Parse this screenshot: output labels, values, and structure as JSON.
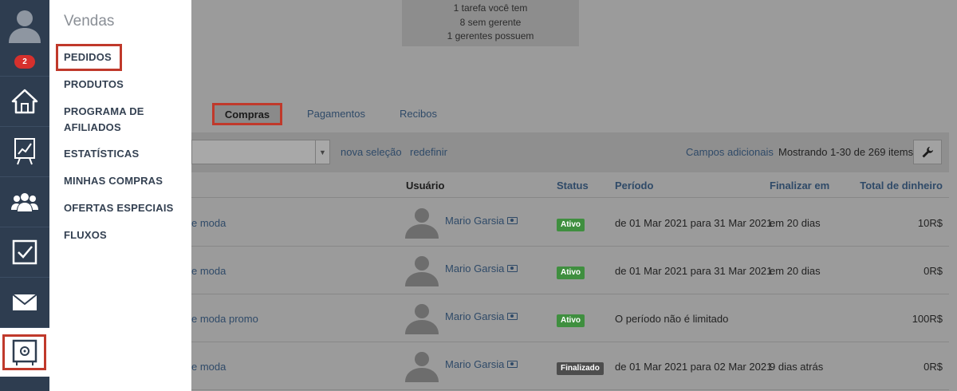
{
  "rail": {
    "badge": "2",
    "icons": [
      "home-icon",
      "chart-icon",
      "users-icon",
      "tasks-icon",
      "mail-icon",
      "sales-icon"
    ]
  },
  "menu": {
    "title": "Vendas",
    "items": [
      {
        "label": "PEDIDOS"
      },
      {
        "label": "PRODUTOS"
      },
      {
        "label": "PROGRAMA DE AFILIADOS"
      },
      {
        "label": "ESTATÍSTICAS"
      },
      {
        "label": "MINHAS COMPRAS"
      },
      {
        "label": "OFERTAS ESPECIAIS"
      },
      {
        "label": "FLUXOS"
      }
    ]
  },
  "summary": {
    "line1": "1 tarefa você tem",
    "line2": "8 sem gerente",
    "line3": "1 gerentes possuem"
  },
  "tabs": {
    "active": "Compras",
    "pagamentos": "Pagamentos",
    "recibos": "Recibos"
  },
  "toolbar": {
    "nova_selecao": "nova seleção",
    "redefinir": "redefinir",
    "campos_adicionais": "Campos adicionais",
    "mostrando": "Mostrando 1-30 de 269 items."
  },
  "table": {
    "headers": {
      "usuario": "Usuário",
      "status": "Status",
      "periodo": "Período",
      "finalizar": "Finalizar em",
      "total": "Total de dinheiro"
    },
    "rows": [
      {
        "name": "e moda",
        "user": "Mario Garsia",
        "status": "Ativo",
        "status_type": "ativo",
        "period": "de 01 Mar 2021 para 31 Mar 2021",
        "end": "em 20 dias",
        "total": "10R$"
      },
      {
        "name": "e moda",
        "user": "Mario Garsia",
        "status": "Ativo",
        "status_type": "ativo",
        "period": "de 01 Mar 2021 para 31 Mar 2021",
        "end": "em 20 dias",
        "total": "0R$"
      },
      {
        "name": "e moda promo",
        "user": "Mario Garsia",
        "status": "Ativo",
        "status_type": "ativo",
        "period": "O período não é limitado",
        "end": "",
        "total": "100R$"
      },
      {
        "name": "e moda",
        "user": "Mario Garsia",
        "status": "Finalizado",
        "status_type": "fin",
        "period": "de 01 Mar 2021 para 02 Mar 2021",
        "end": "9 dias atrás",
        "total": "0R$"
      }
    ]
  }
}
